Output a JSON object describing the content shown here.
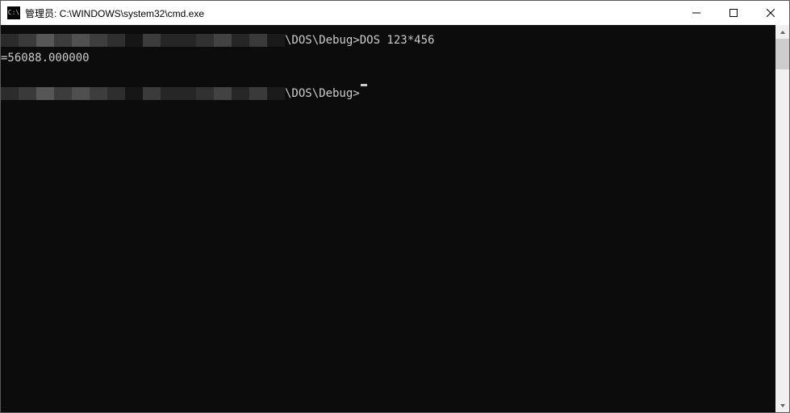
{
  "title": "管理员: C:\\WINDOWS\\system32\\cmd.exe",
  "console": {
    "line1_tail": "\\DOS\\Debug>DOS 123*456",
    "line2": "=56088.000000",
    "line4_tail": "\\DOS\\Debug>"
  },
  "mosaic1": [
    "#2b2b2b",
    "#3a3a3a",
    "#575757",
    "#3c3c3c",
    "#505050",
    "#3e3e3e",
    "#2f2f2f",
    "#161616",
    "#3c3c3c",
    "#262626",
    "#262626",
    "#313131",
    "#424242",
    "#262626",
    "#3a3a3a",
    "#1a1a1a"
  ],
  "mosaic2": [
    "#2c2c2c",
    "#3a3a3a",
    "#565656",
    "#3c3c3c",
    "#4f4f4f",
    "#3d3d3d",
    "#2e2e2e",
    "#161616",
    "#3b3b3b",
    "#262626",
    "#262626",
    "#313131",
    "#424242",
    "#272727",
    "#3a3a3a",
    "#1b1b1b"
  ]
}
